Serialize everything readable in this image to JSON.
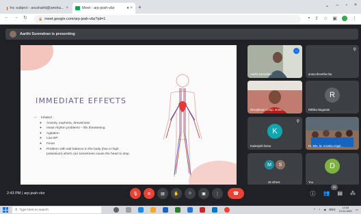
{
  "browser": {
    "tabs": [
      {
        "title": "Inc subject - arushathi@amrita...",
        "icon": "gmail-icon"
      },
      {
        "title": "Meet - arp-jeah-vbz",
        "icon": "meet-icon"
      }
    ],
    "url": "meet.google.com/arp-jeah-vbz?pli=1"
  },
  "meet": {
    "presenting_label": "Aarthi Surendran is presenting",
    "slide": {
      "title": "IMMEDIATE EFFECTS",
      "bullet": "Inhaled",
      "sub_bullets": [
        "Anxiety, euphoria, drowsiness",
        "Heart rhythm problems – life threatening",
        "Agitation",
        "Low BP",
        "Fever",
        "Problem with salt balance in the body (low or high",
        "potassium) which can sometimes cause the heart to stop"
      ]
    },
    "participants": [
      {
        "name": "Aarthi Surendran",
        "type": "video"
      },
      {
        "name": "aruna theertha tha",
        "type": "video"
      },
      {
        "name": "Devadevan Comp. Scien...",
        "type": "video"
      },
      {
        "name": "Rithika Nagarala",
        "type": "avatar",
        "initial": "R",
        "color": "#5f6368"
      },
      {
        "name": "Kadeejath fasna",
        "type": "avatar",
        "initial": "K",
        "color": "#12a4af"
      },
      {
        "name": "Dr. Mrs. M. Anusha Angel...",
        "type": "video"
      },
      {
        "name": "26 others",
        "type": "group",
        "initials": [
          "M",
          "S"
        ],
        "colors": [
          "#1e8e9e",
          "#8d6e63"
        ]
      },
      {
        "name": "You",
        "type": "avatar",
        "initial": "D",
        "color": "#7cb342"
      }
    ],
    "meeting_time": "2:43 PM",
    "meeting_code": "arp-jeah-vbz",
    "participant_count": "34"
  },
  "taskbar": {
    "search_placeholder": "Type here to search",
    "tray_lang": "ENG",
    "clock_time": "14:43",
    "clock_date": "10-02-2021"
  }
}
